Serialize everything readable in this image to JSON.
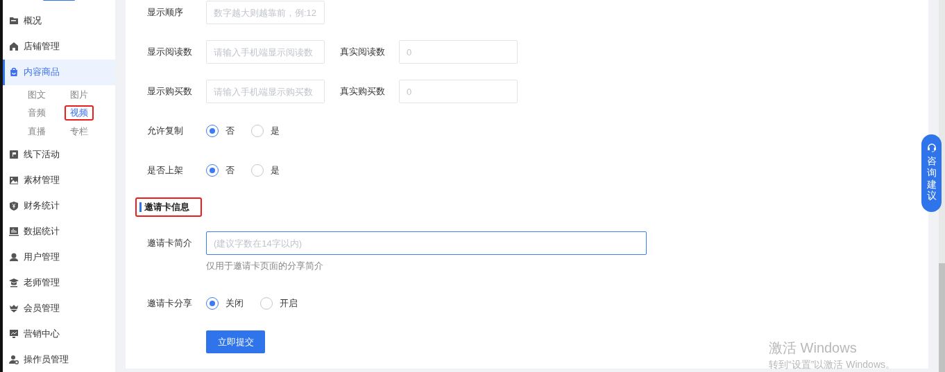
{
  "sidebar": {
    "items": [
      {
        "label": "概况",
        "selected": false
      },
      {
        "label": "店铺管理",
        "selected": false
      },
      {
        "label": "内容商品",
        "selected": true,
        "children": [
          {
            "label": "图文",
            "selected": false,
            "highlighted": false
          },
          {
            "label": "图片",
            "selected": false,
            "highlighted": false
          },
          {
            "label": "音频",
            "selected": false,
            "highlighted": false
          },
          {
            "label": "视频",
            "selected": true,
            "highlighted": true
          },
          {
            "label": "直播",
            "selected": false,
            "highlighted": false
          },
          {
            "label": "专栏",
            "selected": false,
            "highlighted": false
          }
        ]
      },
      {
        "label": "线下活动",
        "selected": false
      },
      {
        "label": "素材管理",
        "selected": false
      },
      {
        "label": "财务统计",
        "selected": false
      },
      {
        "label": "数据统计",
        "selected": false
      },
      {
        "label": "用户管理",
        "selected": false
      },
      {
        "label": "老师管理",
        "selected": false
      },
      {
        "label": "会员管理",
        "selected": false
      },
      {
        "label": "营销中心",
        "selected": false
      },
      {
        "label": "操作员管理",
        "selected": false
      }
    ]
  },
  "form": {
    "rows": [
      {
        "kind": "fields",
        "fields": [
          {
            "label": "显示顺序",
            "placeholder": "数字越大则越靠前，例:12"
          }
        ]
      },
      {
        "kind": "fields",
        "fields": [
          {
            "label": "显示阅读数",
            "placeholder": "请输入手机端显示阅读数"
          },
          {
            "label": "真实阅读数",
            "placeholder": "0"
          }
        ]
      },
      {
        "kind": "fields",
        "fields": [
          {
            "label": "显示购买数",
            "placeholder": "请输入手机端显示购买数"
          },
          {
            "label": "真实购买数",
            "placeholder": "0"
          }
        ]
      },
      {
        "kind": "radio",
        "label": "允许复制",
        "options": [
          {
            "label": "否",
            "selected": true
          },
          {
            "label": "是",
            "selected": false
          }
        ]
      },
      {
        "kind": "radio",
        "label": "是否上架",
        "options": [
          {
            "label": "否",
            "selected": true
          },
          {
            "label": "是",
            "selected": false
          }
        ]
      }
    ],
    "section": {
      "title": "邀请卡信息",
      "highlighted": true
    },
    "invite_rows": [
      {
        "kind": "wide_field",
        "label": "邀请卡简介",
        "placeholder": "(建议字数在14字以内)",
        "focused": true,
        "hint": "仅用于邀请卡页面的分享简介"
      },
      {
        "kind": "radio",
        "label": "邀请卡分享",
        "options": [
          {
            "label": "关闭",
            "selected": true
          },
          {
            "label": "开启",
            "selected": false
          }
        ]
      }
    ],
    "submit": "立即提交"
  },
  "help_button": {
    "label": "咨询建议"
  },
  "os_watermark": {
    "title": "激活 Windows",
    "subtitle": "转到“设置”以激活 Windows。"
  }
}
